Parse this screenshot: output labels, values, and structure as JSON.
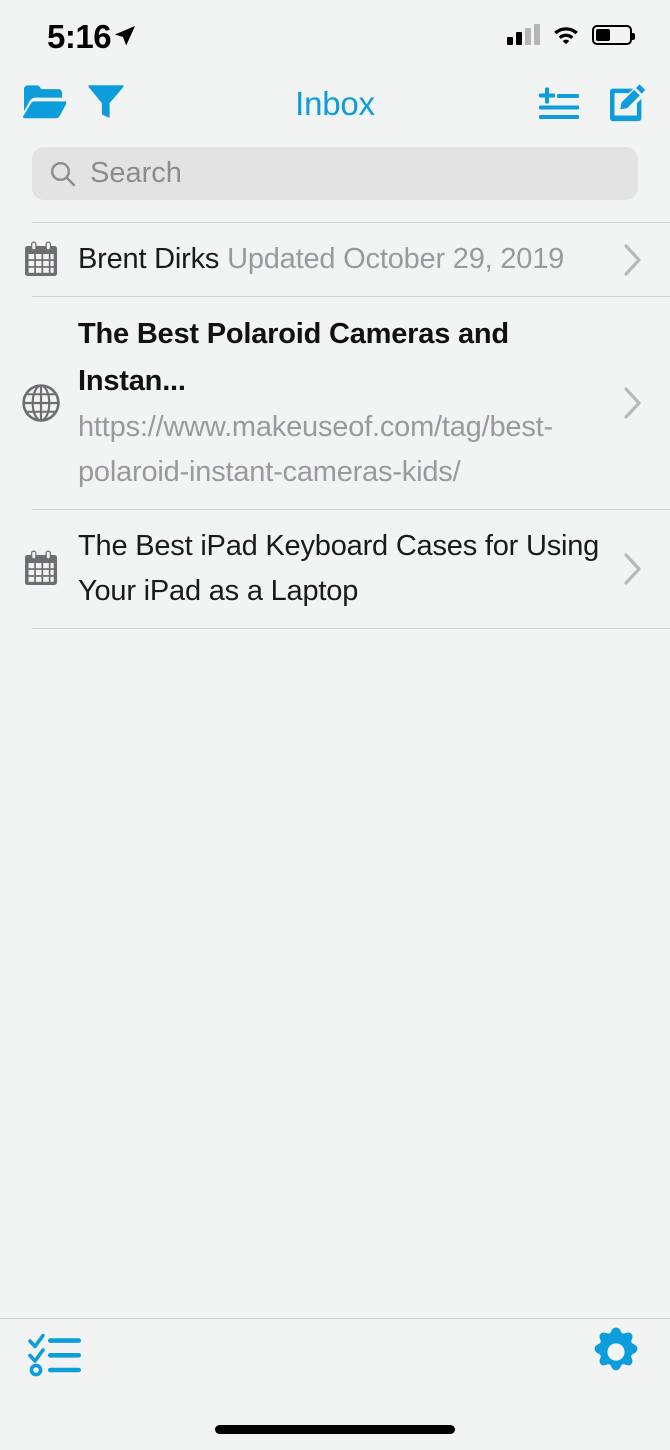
{
  "theme": {
    "accent": "#0d9ddb",
    "background": "#f2f3f3",
    "search_background": "#e3e3e4",
    "separator": "#d2d2d4",
    "text_primary": "#1a1a1a",
    "text_secondary": "#9a9a9e",
    "icon_gray": "#6e6e72"
  },
  "status_bar": {
    "time": "5:16",
    "location_icon": "location-arrow-icon",
    "cellular_icon": "cellular-signal-icon",
    "cellular_bars_active": 2,
    "cellular_bars_total": 4,
    "wifi_icon": "wifi-icon",
    "battery_icon": "battery-icon",
    "battery_percent": 45
  },
  "nav_bar": {
    "title": "Inbox",
    "left_buttons": [
      {
        "name": "folder-icon",
        "label": "Folders"
      },
      {
        "name": "filter-icon",
        "label": "Filter"
      }
    ],
    "right_buttons": [
      {
        "name": "add-to-list-icon",
        "label": "Add to List"
      },
      {
        "name": "compose-icon",
        "label": "Compose"
      }
    ]
  },
  "search": {
    "placeholder": "Search",
    "value": "",
    "icon": "search-icon"
  },
  "list": {
    "rows": [
      {
        "icon": "calendar-icon",
        "style": "single",
        "segments": [
          {
            "text": "Brent Dirks ",
            "tone": "dark"
          },
          {
            "text": "Updated October 29, 2019",
            "tone": "gray"
          }
        ],
        "chevron": "chevron-right-icon"
      },
      {
        "icon": "globe-icon",
        "style": "title-subtitle",
        "title": "The Best Polaroid Cameras and Instan...",
        "subtitle": "https://www.makeuseof.com/tag/best-polaroid-instant-cameras-kids/",
        "chevron": "chevron-right-icon"
      },
      {
        "icon": "calendar-icon",
        "style": "two-line",
        "line1": "The Best iPad Keyboard Cases for Using",
        "line2": "Your iPad as a Laptop",
        "chevron": "chevron-right-icon"
      }
    ]
  },
  "bottom_bar": {
    "left_button": {
      "name": "checklist-icon",
      "label": "Lists"
    },
    "right_button": {
      "name": "gear-icon",
      "label": "Settings"
    }
  }
}
